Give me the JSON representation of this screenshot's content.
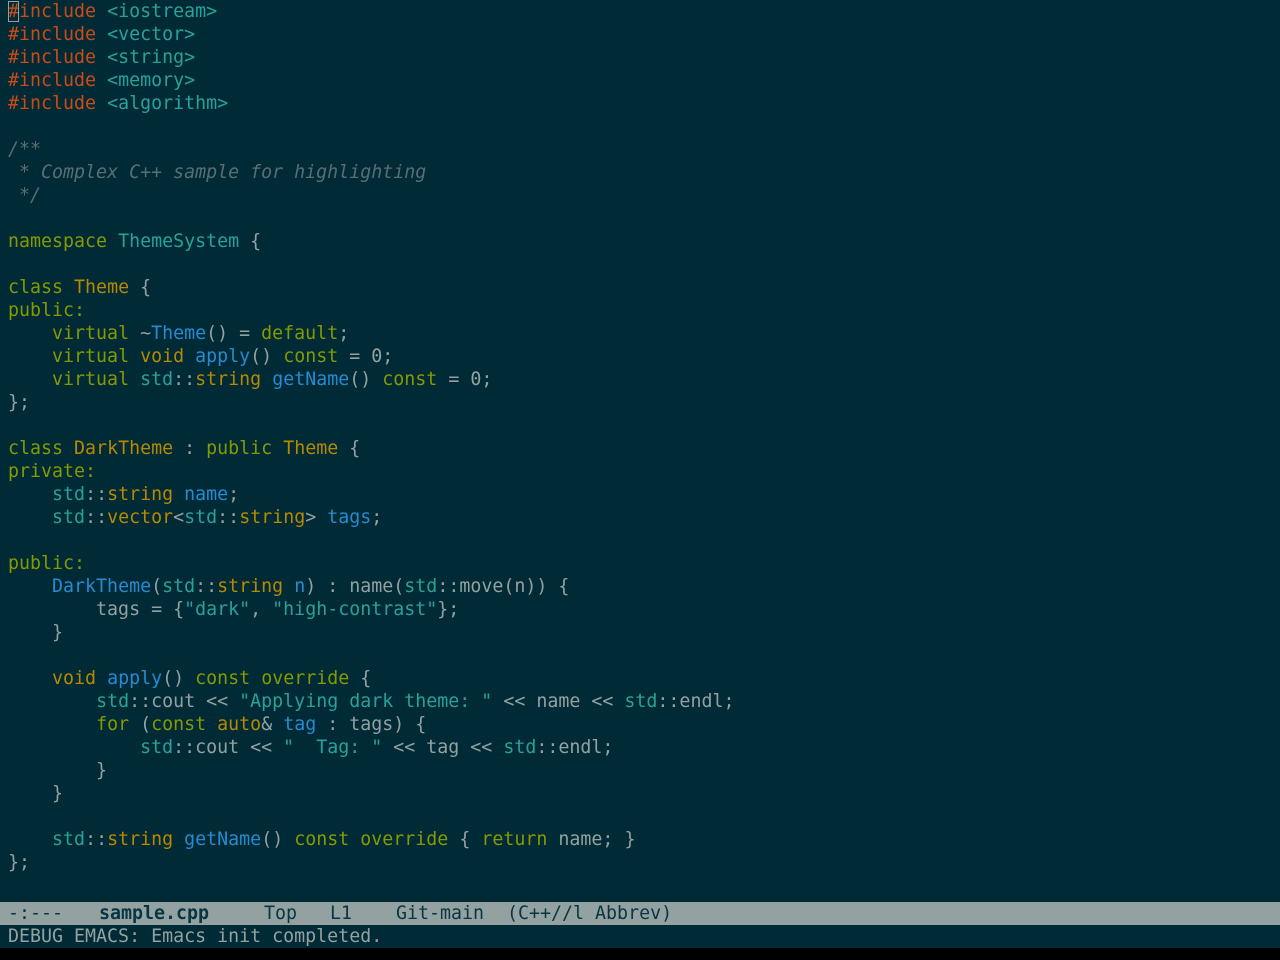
{
  "colors": {
    "background": "#002b36",
    "preprocessor": "#cb4b16",
    "string": "#2aa198",
    "keyword": "#859900",
    "type": "#b58900",
    "function": "#268bd2",
    "comment": "#586e75",
    "text": "#93a1a1",
    "modeline_bg": "#93a1a1",
    "modeline_fg": "#073642"
  },
  "buffer": {
    "lines": [
      [
        [
          "pp",
          "#include"
        ],
        [
          "pl",
          " "
        ],
        [
          "inc",
          "<iostream>"
        ]
      ],
      [
        [
          "pp",
          "#include"
        ],
        [
          "pl",
          " "
        ],
        [
          "inc",
          "<vector>"
        ]
      ],
      [
        [
          "pp",
          "#include"
        ],
        [
          "pl",
          " "
        ],
        [
          "inc",
          "<string>"
        ]
      ],
      [
        [
          "pp",
          "#include"
        ],
        [
          "pl",
          " "
        ],
        [
          "inc",
          "<memory>"
        ]
      ],
      [
        [
          "pp",
          "#include"
        ],
        [
          "pl",
          " "
        ],
        [
          "inc",
          "<algorithm>"
        ]
      ],
      [],
      [
        [
          "cm",
          "/**"
        ]
      ],
      [
        [
          "cm",
          " * Complex C++ sample for highlighting"
        ]
      ],
      [
        [
          "cm",
          " */"
        ]
      ],
      [],
      [
        [
          "kw",
          "namespace"
        ],
        [
          "pl",
          " "
        ],
        [
          "ns",
          "ThemeSystem"
        ],
        [
          "pl",
          " {"
        ]
      ],
      [],
      [
        [
          "kw",
          "class"
        ],
        [
          "pl",
          " "
        ],
        [
          "ty",
          "Theme"
        ],
        [
          "pl",
          " {"
        ]
      ],
      [
        [
          "kw",
          "public:"
        ]
      ],
      [
        [
          "pl",
          "    "
        ],
        [
          "kw",
          "virtual"
        ],
        [
          "pl",
          " ~"
        ],
        [
          "fn",
          "Theme"
        ],
        [
          "pl",
          "() = "
        ],
        [
          "kw",
          "default"
        ],
        [
          "pl",
          ";"
        ]
      ],
      [
        [
          "pl",
          "    "
        ],
        [
          "kw",
          "virtual"
        ],
        [
          "pl",
          " "
        ],
        [
          "ty",
          "void"
        ],
        [
          "pl",
          " "
        ],
        [
          "fn",
          "apply"
        ],
        [
          "pl",
          "() "
        ],
        [
          "kw",
          "const"
        ],
        [
          "pl",
          " = 0;"
        ]
      ],
      [
        [
          "pl",
          "    "
        ],
        [
          "kw",
          "virtual"
        ],
        [
          "pl",
          " "
        ],
        [
          "ns",
          "std"
        ],
        [
          "pl",
          "::"
        ],
        [
          "ty",
          "string"
        ],
        [
          "pl",
          " "
        ],
        [
          "fn",
          "getName"
        ],
        [
          "pl",
          "() "
        ],
        [
          "kw",
          "const"
        ],
        [
          "pl",
          " = 0;"
        ]
      ],
      [
        [
          "pl",
          "};"
        ]
      ],
      [],
      [
        [
          "kw",
          "class"
        ],
        [
          "pl",
          " "
        ],
        [
          "ty",
          "DarkTheme"
        ],
        [
          "pl",
          " : "
        ],
        [
          "kw",
          "public"
        ],
        [
          "pl",
          " "
        ],
        [
          "ty",
          "Theme"
        ],
        [
          "pl",
          " {"
        ]
      ],
      [
        [
          "kw",
          "private:"
        ]
      ],
      [
        [
          "pl",
          "    "
        ],
        [
          "ns",
          "std"
        ],
        [
          "pl",
          "::"
        ],
        [
          "ty",
          "string"
        ],
        [
          "pl",
          " "
        ],
        [
          "var",
          "name"
        ],
        [
          "pl",
          ";"
        ]
      ],
      [
        [
          "pl",
          "    "
        ],
        [
          "ns",
          "std"
        ],
        [
          "pl",
          "::"
        ],
        [
          "ty",
          "vector"
        ],
        [
          "pl",
          "<"
        ],
        [
          "ns",
          "std"
        ],
        [
          "pl",
          "::"
        ],
        [
          "ty",
          "string"
        ],
        [
          "pl",
          "> "
        ],
        [
          "var",
          "tags"
        ],
        [
          "pl",
          ";"
        ]
      ],
      [],
      [
        [
          "kw",
          "public:"
        ]
      ],
      [
        [
          "pl",
          "    "
        ],
        [
          "fn",
          "DarkTheme"
        ],
        [
          "pl",
          "("
        ],
        [
          "ns",
          "std"
        ],
        [
          "pl",
          "::"
        ],
        [
          "ty",
          "string"
        ],
        [
          "pl",
          " "
        ],
        [
          "var",
          "n"
        ],
        [
          "pl",
          ") : name("
        ],
        [
          "ns",
          "std"
        ],
        [
          "pl",
          "::move(n)) {"
        ]
      ],
      [
        [
          "pl",
          "        tags = {"
        ],
        [
          "str",
          "\"dark\""
        ],
        [
          "pl",
          ", "
        ],
        [
          "str",
          "\"high-contrast\""
        ],
        [
          "pl",
          "};"
        ]
      ],
      [
        [
          "pl",
          "    }"
        ]
      ],
      [],
      [
        [
          "pl",
          "    "
        ],
        [
          "ty",
          "void"
        ],
        [
          "pl",
          " "
        ],
        [
          "fn",
          "apply"
        ],
        [
          "pl",
          "() "
        ],
        [
          "kw",
          "const"
        ],
        [
          "pl",
          " "
        ],
        [
          "kw",
          "override"
        ],
        [
          "pl",
          " {"
        ]
      ],
      [
        [
          "pl",
          "        "
        ],
        [
          "ns",
          "std"
        ],
        [
          "pl",
          "::cout << "
        ],
        [
          "str",
          "\"Applying dark theme: \""
        ],
        [
          "pl",
          " << name << "
        ],
        [
          "ns",
          "std"
        ],
        [
          "pl",
          "::endl;"
        ]
      ],
      [
        [
          "pl",
          "        "
        ],
        [
          "kw",
          "for"
        ],
        [
          "pl",
          " ("
        ],
        [
          "kw",
          "const"
        ],
        [
          "pl",
          " "
        ],
        [
          "ty",
          "auto"
        ],
        [
          "pl",
          "& "
        ],
        [
          "var",
          "tag"
        ],
        [
          "pl",
          " : tags) {"
        ]
      ],
      [
        [
          "pl",
          "            "
        ],
        [
          "ns",
          "std"
        ],
        [
          "pl",
          "::cout << "
        ],
        [
          "str",
          "\"  Tag: \""
        ],
        [
          "pl",
          " << tag << "
        ],
        [
          "ns",
          "std"
        ],
        [
          "pl",
          "::endl;"
        ]
      ],
      [
        [
          "pl",
          "        }"
        ]
      ],
      [
        [
          "pl",
          "    }"
        ]
      ],
      [],
      [
        [
          "pl",
          "    "
        ],
        [
          "ns",
          "std"
        ],
        [
          "pl",
          "::"
        ],
        [
          "ty",
          "string"
        ],
        [
          "pl",
          " "
        ],
        [
          "fn",
          "getName"
        ],
        [
          "pl",
          "() "
        ],
        [
          "kw",
          "const"
        ],
        [
          "pl",
          " "
        ],
        [
          "kw",
          "override"
        ],
        [
          "pl",
          " { "
        ],
        [
          "kw",
          "return"
        ],
        [
          "pl",
          " name; }"
        ]
      ],
      [
        [
          "pl",
          "};"
        ]
      ]
    ]
  },
  "modeline": {
    "status": "-:---",
    "buffer_name": "sample.cpp",
    "position": "Top",
    "line": "L1",
    "vc": "Git-main",
    "modes": "(C++//l Abbrev)"
  },
  "minibuffer": {
    "message": "DEBUG EMACS: Emacs init completed."
  }
}
